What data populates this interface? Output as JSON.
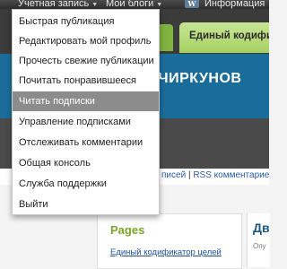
{
  "admin_bar": {
    "account_label": "Учетная запись",
    "my_blogs_label": "Мои блоги",
    "wp_logo_text": "W",
    "info_label": "Информация"
  },
  "page": {
    "tab_label": "Единый кодификатор",
    "banner_title": "ЕТ ЧИРКУНОВ",
    "rss_posts": "писей",
    "rss_separator": "|",
    "rss_comments": "RSS комментарие",
    "pages_title": "Pages",
    "pages_link": "Единый кодификатор целей",
    "right_title": "Дв",
    "right_sub": "Опу"
  },
  "dropdown": {
    "items": [
      {
        "label": "Быстрая публикация"
      },
      {
        "label": "Редактировать мой профиль"
      },
      {
        "label": "Прочесть свежие публикации"
      },
      {
        "label": "Почитать понравившееся"
      },
      {
        "label": "Читать подписки"
      },
      {
        "label": "Управление подписками"
      },
      {
        "label": "Отслеживать комментарии"
      },
      {
        "label": "Общая консоль"
      },
      {
        "label": "Служба поддержки"
      },
      {
        "label": "Выйти"
      }
    ],
    "active_index": 4
  },
  "colors": {
    "admin_bar": "#333333",
    "menu_highlight": "#8c8c8c",
    "banner_blue": "#1a6d9a",
    "tab_green": "#a6d162",
    "pages_title_green": "#77a524",
    "link_blue": "#1f4fa8"
  }
}
